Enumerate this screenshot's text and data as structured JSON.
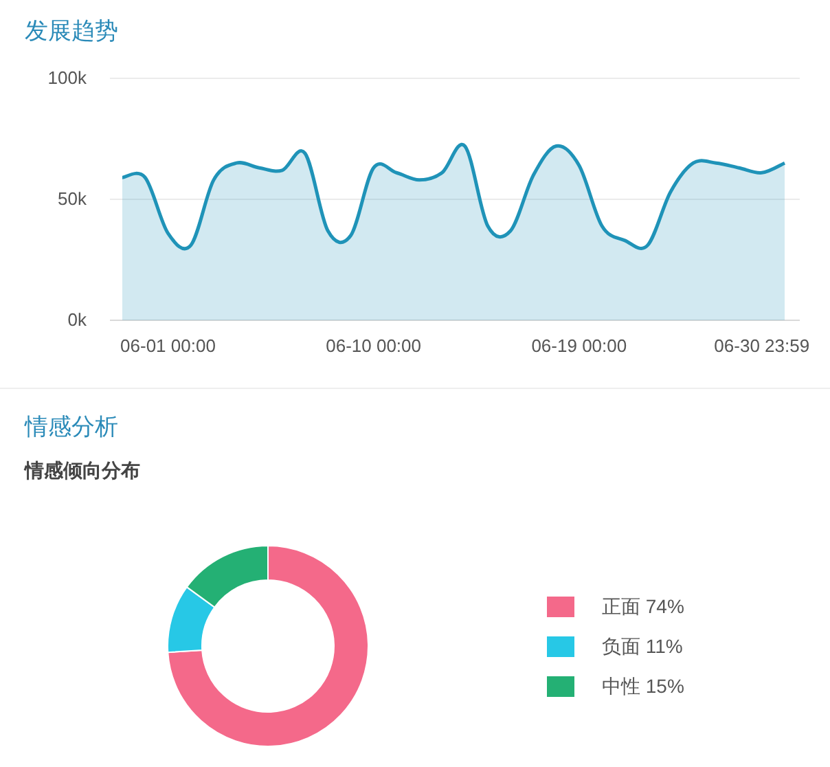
{
  "trend": {
    "title": "发展趋势",
    "chart_data": {
      "type": "area",
      "categories": [
        null,
        null,
        "06-01 00:00",
        null,
        null,
        null,
        null,
        null,
        null,
        null,
        null,
        "06-10 00:00",
        null,
        null,
        null,
        null,
        null,
        null,
        null,
        null,
        "06-19 00:00",
        null,
        null,
        null,
        null,
        null,
        null,
        null,
        "06-30 23:59",
        null
      ],
      "series": [
        {
          "color": "#1f93b8",
          "values": [
            59,
            59,
            36,
            31,
            58,
            65,
            63,
            62,
            69,
            37,
            35,
            63,
            61,
            58,
            61,
            72,
            39,
            37,
            60,
            72,
            64,
            39,
            33,
            31,
            53,
            65,
            65,
            63,
            61,
            65
          ]
        }
      ],
      "ylim": [
        0,
        100
      ],
      "yticks": [
        {
          "value": 0,
          "label": "0k"
        },
        {
          "value": 50,
          "label": "50k"
        },
        {
          "value": 100,
          "label": "100k"
        }
      ]
    }
  },
  "sentiment": {
    "title": "情感分析",
    "subtitle": "情感倾向分布",
    "chart_data": {
      "type": "donut",
      "categories": [
        "正面",
        "负面",
        "中性"
      ],
      "values": [
        74,
        11,
        15
      ]
    },
    "legend": [
      {
        "percent": "74%",
        "color": "#f4698a"
      },
      {
        "percent": "11%",
        "color": "#27c8e6"
      },
      {
        "percent": "15%",
        "color": "#24b074"
      }
    ]
  }
}
